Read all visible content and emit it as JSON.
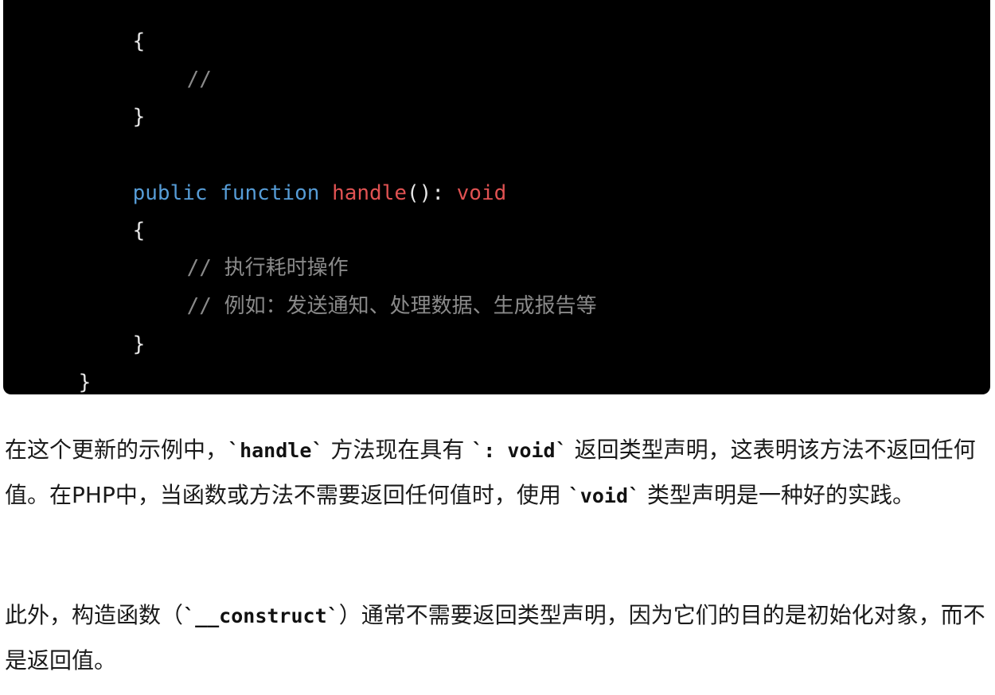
{
  "code_block": {
    "lines": [
      {
        "text": "{"
      },
      {
        "comment": "//"
      },
      {
        "text": "}"
      },
      {
        "kw1": "public",
        "kw2": "function",
        "fn": "handle",
        "punc": "():",
        "type": "void"
      },
      {
        "text": "{"
      },
      {
        "comment": "// 执行耗时操作"
      },
      {
        "comment": "// 例如：发送通知、处理数据、生成报告等"
      },
      {
        "text": "}"
      },
      {
        "text": "}"
      }
    ]
  },
  "paragraph1": {
    "part1": "在这个更新的示例中，",
    "code1": "`handle`",
    "part2": " 方法现在具有 ",
    "code2": "`: void`",
    "part3": " 返回类型声明，这表明该方法不返回任何值。在PHP中，当函数或方法不需要返回任何值时，使用 ",
    "code3": "`void`",
    "part4": " 类型声明是一种好的实践。"
  },
  "paragraph2": {
    "part1": "此外，构造函数（",
    "code1": "`__construct`",
    "part2": "）通常不需要返回类型声明，因为它们的目的是初始化对象，而不是返回值。"
  }
}
